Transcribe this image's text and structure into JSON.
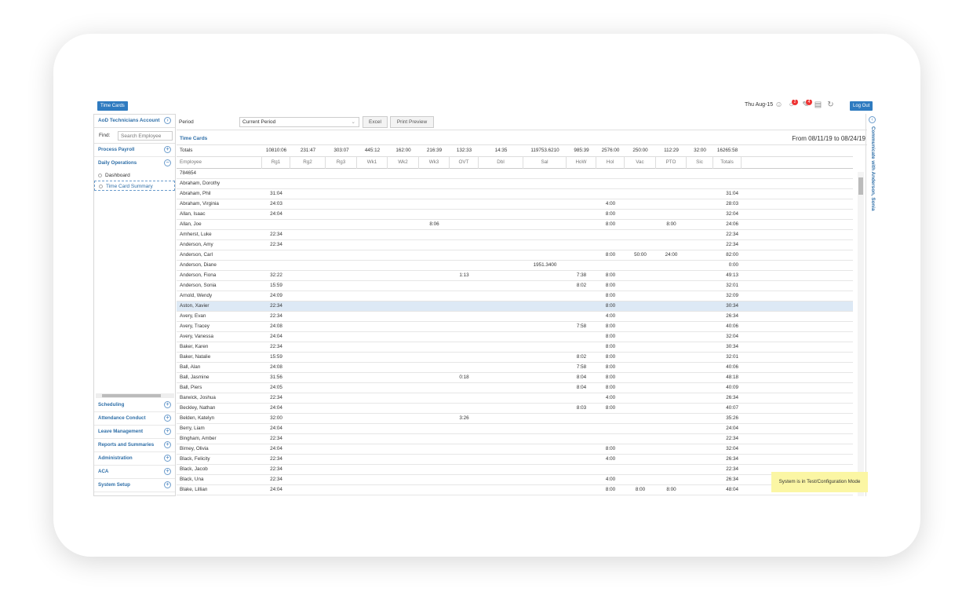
{
  "app": {
    "title_button": "Time Cards",
    "date": "Thu Aug-15",
    "logout_label": "Log Out",
    "alerts_badge": "2",
    "messages_badge": "4"
  },
  "sidebar": {
    "account": "AoD Technicians Account",
    "find_label": "Find:",
    "search_placeholder": "Search Employee",
    "sections_top": [
      "Process Payroll",
      "Daily Operations"
    ],
    "daily_items": [
      "Dashboard",
      "Time Card Summary"
    ],
    "sections_bottom": [
      "Scheduling",
      "Attendance Conduct",
      "Leave Management",
      "Reports and Summaries",
      "Administration",
      "ACA",
      "System Setup"
    ]
  },
  "period": {
    "label": "Period",
    "selected": "Current Period",
    "excel_label": "Excel",
    "print_label": "Print Preview"
  },
  "timecards": {
    "title": "Time Cards",
    "date_range": "From 08/11/19 to 08/24/19"
  },
  "table": {
    "columns": [
      "Employee",
      "Rg1",
      "Rg2",
      "Rg3",
      "Wk1",
      "Wk2",
      "Wk3",
      "OVT",
      "Dbl",
      "Sal",
      "HoW",
      "Hol",
      "Vac",
      "PTO",
      "Sic",
      "Totals"
    ],
    "totals_label": "Totals",
    "totals": [
      "10810:06",
      "231:47",
      "303:07",
      "445:12",
      "162:00",
      "216:39",
      "132:33",
      "14:35",
      "119753.6210",
      "985:39",
      "2576:00",
      "250:00",
      "112:29",
      "32:00",
      "16265:58"
    ],
    "rows": [
      {
        "name": "784654",
        "v": [
          "",
          "",
          "",
          "",
          "",
          "",
          "",
          "",
          "",
          "",
          "",
          "",
          "",
          "",
          ""
        ]
      },
      {
        "name": "Abraham, Dorothy",
        "v": [
          "",
          "",
          "",
          "",
          "",
          "",
          "",
          "",
          "",
          "",
          "",
          "",
          "",
          "",
          ""
        ]
      },
      {
        "name": "Abraham, Phil",
        "v": [
          "31:04",
          "",
          "",
          "",
          "",
          "",
          "",
          "",
          "",
          "",
          "",
          "",
          "",
          "",
          "31:04"
        ]
      },
      {
        "name": "Abraham, Virginia",
        "v": [
          "24:03",
          "",
          "",
          "",
          "",
          "",
          "",
          "",
          "",
          "",
          "4:00",
          "",
          "",
          "",
          "28:03"
        ]
      },
      {
        "name": "Allan, Isaac",
        "v": [
          "24:04",
          "",
          "",
          "",
          "",
          "",
          "",
          "",
          "",
          "",
          "8:00",
          "",
          "",
          "",
          "32:04"
        ]
      },
      {
        "name": "Allan, Joe",
        "v": [
          "",
          "",
          "",
          "",
          "",
          "8:06",
          "",
          "",
          "",
          "",
          "8:00",
          "",
          "8:00",
          "",
          "24:06"
        ]
      },
      {
        "name": "Amherst, Luke",
        "v": [
          "22:34",
          "",
          "",
          "",
          "",
          "",
          "",
          "",
          "",
          "",
          "",
          "",
          "",
          "",
          "22:34"
        ]
      },
      {
        "name": "Anderson, Amy",
        "v": [
          "22:34",
          "",
          "",
          "",
          "",
          "",
          "",
          "",
          "",
          "",
          "",
          "",
          "",
          "",
          "22:34"
        ]
      },
      {
        "name": "Anderson, Carl",
        "v": [
          "",
          "",
          "",
          "",
          "",
          "",
          "",
          "",
          "",
          "",
          "8:00",
          "50:00",
          "24:00",
          "",
          "82:00"
        ]
      },
      {
        "name": "Anderson, Diane",
        "v": [
          "",
          "",
          "",
          "",
          "",
          "",
          "",
          "",
          "1951.3400",
          "",
          "",
          "",
          "",
          "",
          "0:00"
        ]
      },
      {
        "name": "Anderson, Fiona",
        "v": [
          "32:22",
          "",
          "",
          "",
          "",
          "",
          "1:13",
          "",
          "",
          "7:38",
          "8:00",
          "",
          "",
          "",
          "49:13"
        ]
      },
      {
        "name": "Anderson, Sonia",
        "v": [
          "15:59",
          "",
          "",
          "",
          "",
          "",
          "",
          "",
          "",
          "8:02",
          "8:00",
          "",
          "",
          "",
          "32:01"
        ]
      },
      {
        "name": "Arnold, Wendy",
        "v": [
          "24:09",
          "",
          "",
          "",
          "",
          "",
          "",
          "",
          "",
          "",
          "8:00",
          "",
          "",
          "",
          "32:09"
        ]
      },
      {
        "name": "Aston, Xavier",
        "v": [
          "22:34",
          "",
          "",
          "",
          "",
          "",
          "",
          "",
          "",
          "",
          "8:00",
          "",
          "",
          "",
          "30:34"
        ],
        "selected": true
      },
      {
        "name": "Avery, Evan",
        "v": [
          "22:34",
          "",
          "",
          "",
          "",
          "",
          "",
          "",
          "",
          "",
          "4:00",
          "",
          "",
          "",
          "26:34"
        ]
      },
      {
        "name": "Avery, Tracey",
        "v": [
          "24:08",
          "",
          "",
          "",
          "",
          "",
          "",
          "",
          "",
          "7:58",
          "8:00",
          "",
          "",
          "",
          "40:06"
        ]
      },
      {
        "name": "Avery, Vanessa",
        "v": [
          "24:04",
          "",
          "",
          "",
          "",
          "",
          "",
          "",
          "",
          "",
          "8:00",
          "",
          "",
          "",
          "32:04"
        ]
      },
      {
        "name": "Baker, Karen",
        "v": [
          "22:34",
          "",
          "",
          "",
          "",
          "",
          "",
          "",
          "",
          "",
          "8:00",
          "",
          "",
          "",
          "30:34"
        ]
      },
      {
        "name": "Baker, Natalie",
        "v": [
          "15:59",
          "",
          "",
          "",
          "",
          "",
          "",
          "",
          "",
          "8:02",
          "8:00",
          "",
          "",
          "",
          "32:01"
        ]
      },
      {
        "name": "Ball, Alan",
        "v": [
          "24:08",
          "",
          "",
          "",
          "",
          "",
          "",
          "",
          "",
          "7:58",
          "8:00",
          "",
          "",
          "",
          "40:06"
        ]
      },
      {
        "name": "Ball, Jasmine",
        "v": [
          "31:56",
          "",
          "",
          "",
          "",
          "",
          "0:18",
          "",
          "",
          "8:04",
          "8:00",
          "",
          "",
          "",
          "48:18"
        ]
      },
      {
        "name": "Ball, Piers",
        "v": [
          "24:05",
          "",
          "",
          "",
          "",
          "",
          "",
          "",
          "",
          "8:04",
          "8:00",
          "",
          "",
          "",
          "40:09"
        ]
      },
      {
        "name": "Barwick, Joshua",
        "v": [
          "22:34",
          "",
          "",
          "",
          "",
          "",
          "",
          "",
          "",
          "",
          "4:00",
          "",
          "",
          "",
          "26:34"
        ]
      },
      {
        "name": "Beckley, Nathan",
        "v": [
          "24:04",
          "",
          "",
          "",
          "",
          "",
          "",
          "",
          "",
          "8:03",
          "8:00",
          "",
          "",
          "",
          "40:07"
        ]
      },
      {
        "name": "Belden, Katelyn",
        "v": [
          "32:00",
          "",
          "",
          "",
          "",
          "",
          "3:26",
          "",
          "",
          "",
          "",
          "",
          "",
          "",
          "35:26"
        ]
      },
      {
        "name": "Berry, Liam",
        "v": [
          "24:04",
          "",
          "",
          "",
          "",
          "",
          "",
          "",
          "",
          "",
          "",
          "",
          "",
          "",
          "24:04"
        ]
      },
      {
        "name": "Bingham, Amber",
        "v": [
          "22:34",
          "",
          "",
          "",
          "",
          "",
          "",
          "",
          "",
          "",
          "",
          "",
          "",
          "",
          "22:34"
        ]
      },
      {
        "name": "Birney, Olivia",
        "v": [
          "24:04",
          "",
          "",
          "",
          "",
          "",
          "",
          "",
          "",
          "",
          "8:00",
          "",
          "",
          "",
          "32:04"
        ]
      },
      {
        "name": "Black, Felicity",
        "v": [
          "22:34",
          "",
          "",
          "",
          "",
          "",
          "",
          "",
          "",
          "",
          "4:00",
          "",
          "",
          "",
          "26:34"
        ]
      },
      {
        "name": "Black, Jacob",
        "v": [
          "22:34",
          "",
          "",
          "",
          "",
          "",
          "",
          "",
          "",
          "",
          "",
          "",
          "",
          "",
          "22:34"
        ]
      },
      {
        "name": "Black, Una",
        "v": [
          "22:34",
          "",
          "",
          "",
          "",
          "",
          "",
          "",
          "",
          "",
          "4:00",
          "",
          "",
          "",
          "26:34"
        ]
      },
      {
        "name": "Blake, Lillian",
        "v": [
          "24:04",
          "",
          "",
          "",
          "",
          "",
          "",
          "",
          "",
          "",
          "8:00",
          "8:00",
          "8:00",
          "",
          "48:04"
        ]
      }
    ]
  },
  "right_pane": {
    "label": "Communicate with Anderson, Sonia"
  },
  "toast": "System is in Test/Configuration Mode",
  "colors": {
    "accent": "#2f7bc0",
    "link": "#2f6fa8",
    "selected_row": "#dde9f5",
    "toast_bg": "#fbf6a4"
  }
}
